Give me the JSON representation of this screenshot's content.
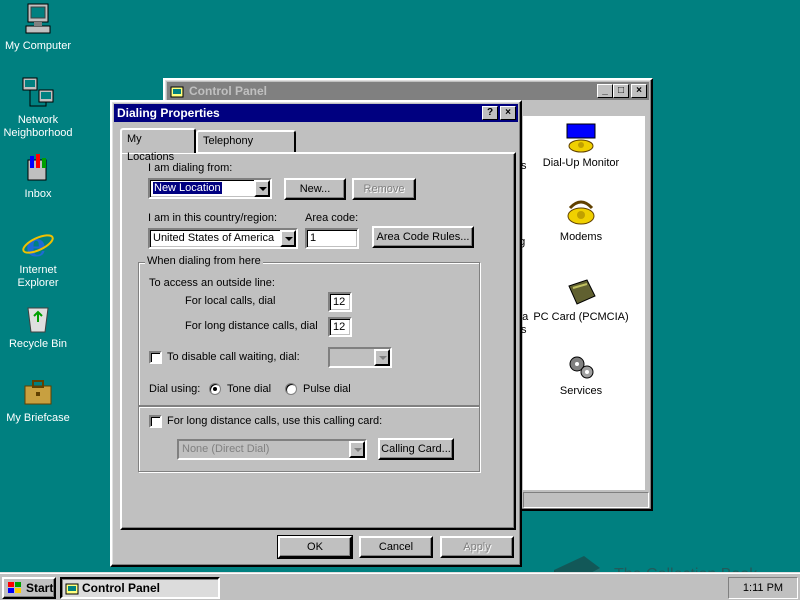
{
  "desktop": {
    "icons": [
      {
        "label": "My Computer"
      },
      {
        "label": "Network Neighborhood"
      },
      {
        "label": "Inbox"
      },
      {
        "label": "Internet Explorer"
      },
      {
        "label": "Recycle Bin"
      },
      {
        "label": "My Briefcase"
      }
    ]
  },
  "control_panel": {
    "title": "Control Panel",
    "items": [
      {
        "label": "Dial-Up Monitor"
      },
      {
        "label": "Modems"
      },
      {
        "label": "PC Card (PCMCIA)"
      },
      {
        "label": "Services"
      }
    ],
    "partial_labels": [
      "s",
      "ng",
      "ata",
      "s"
    ]
  },
  "dialog": {
    "title": "Dialing Properties",
    "tabs": [
      {
        "label": "My Locations"
      },
      {
        "label": "Telephony Drivers"
      }
    ],
    "dialing_from_label": "I am dialing from:",
    "dialing_from_value": "New Location",
    "new_button": "New...",
    "remove_button": "Remove",
    "country_label": "I am in this country/region:",
    "country_value": "United States of America",
    "area_code_label": "Area code:",
    "area_code_value": "1",
    "area_code_rules_button": "Area Code Rules...",
    "when_dialing_group": "When dialing from here",
    "outside_line_label": "To access an outside line:",
    "local_label": "For local calls, dial",
    "local_value": "12",
    "long_distance_label": "For long distance calls, dial",
    "long_distance_value": "12",
    "call_waiting_label": "To disable call waiting, dial:",
    "dial_using_label": "Dial using:",
    "tone_label": "Tone dial",
    "pulse_label": "Pulse dial",
    "calling_card_label": "For long distance calls, use this calling card:",
    "calling_card_value": "None (Direct Dial)",
    "calling_card_button": "Calling Card...",
    "ok_button": "OK",
    "cancel_button": "Cancel",
    "apply_button": "Apply",
    "help_button": "?",
    "close_button": "×"
  },
  "taskbar": {
    "start_label": "Start",
    "task_label": "Control Panel",
    "clock": "1:11 PM"
  },
  "watermark": "The Collection Book"
}
